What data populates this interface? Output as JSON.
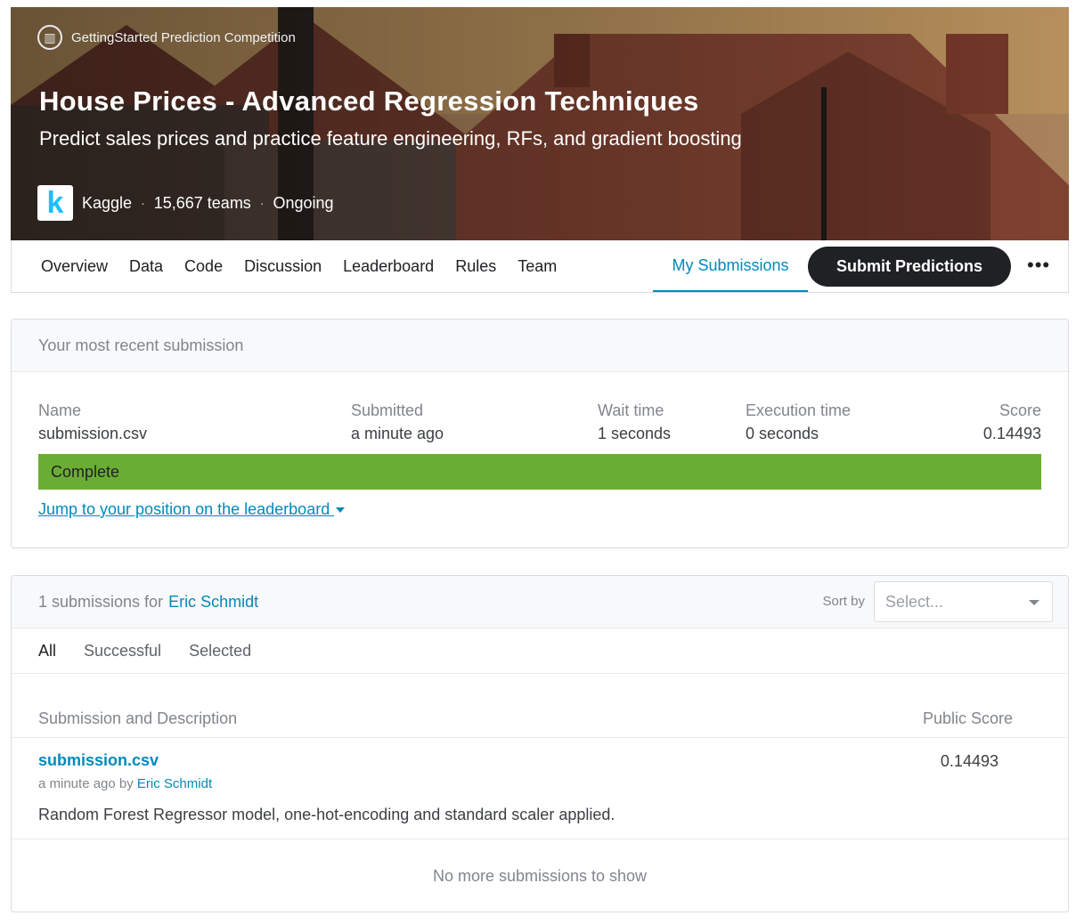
{
  "header": {
    "competition_type": "GettingStarted Prediction Competition",
    "title": "House Prices - Advanced Regression Techniques",
    "subtitle": "Predict sales prices and practice feature engineering, RFs, and gradient boosting",
    "host": "Kaggle",
    "teams": "15,667 teams",
    "status": "Ongoing",
    "separator": "·"
  },
  "nav": {
    "tabs": [
      "Overview",
      "Data",
      "Code",
      "Discussion",
      "Leaderboard",
      "Rules",
      "Team"
    ],
    "active_tab": "My Submissions",
    "submit_label": "Submit Predictions",
    "more_label": "•••"
  },
  "recent": {
    "heading": "Your most recent submission",
    "name_label": "Name",
    "name_value": "submission.csv",
    "submitted_label": "Submitted",
    "submitted_value": "a minute ago",
    "wait_label": "Wait time",
    "wait_value": "1 seconds",
    "exec_label": "Execution time",
    "exec_value": "0 seconds",
    "score_label": "Score",
    "score_value": "0.14493",
    "status": "Complete",
    "status_color": "#6aad34",
    "jump_link": "Jump to your position on the leaderboard"
  },
  "submissions": {
    "count_text": "1 submissions for",
    "user": "Eric Schmidt",
    "sort_label": "Sort by",
    "sort_placeholder": "Select...",
    "filters": [
      "All",
      "Successful",
      "Selected"
    ],
    "col_description": "Submission and Description",
    "col_score": "Public Score",
    "rows": [
      {
        "file": "submission.csv",
        "time": "a minute ago by",
        "author": "Eric Schmidt",
        "description": "Random Forest Regressor model, one-hot-encoding and standard scaler applied.",
        "score": "0.14493"
      }
    ],
    "empty_text": "No more submissions to show"
  },
  "colors": {
    "accent": "#008abc",
    "dark_button": "#202124"
  }
}
